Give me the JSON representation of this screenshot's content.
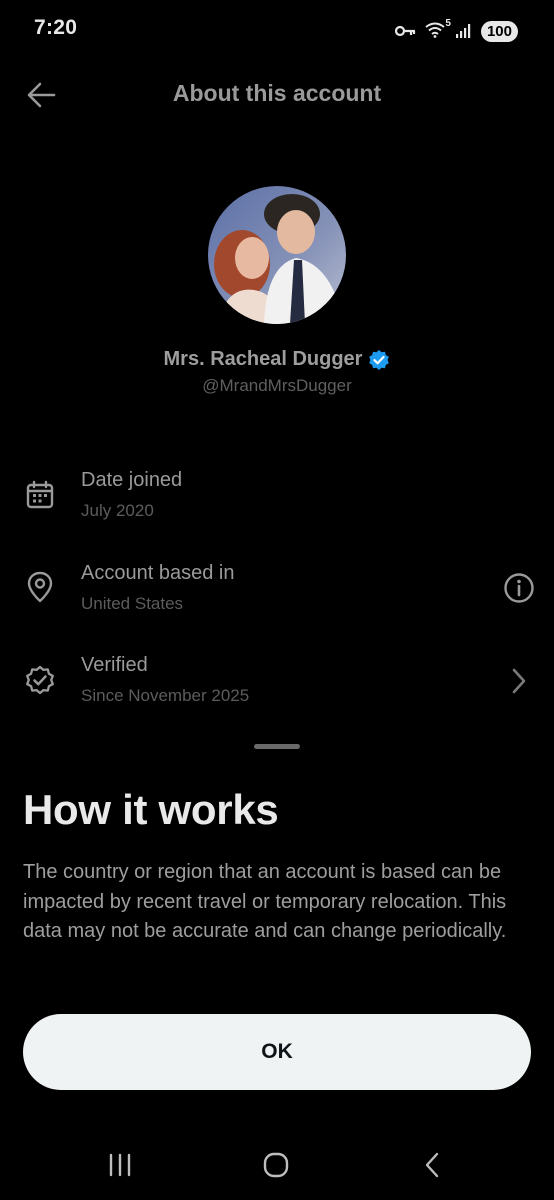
{
  "status_bar": {
    "time": "7:20",
    "network": "5",
    "battery": "100"
  },
  "header": {
    "title": "About this account",
    "back_icon": "arrow-left-icon"
  },
  "profile": {
    "name": "Mrs. Racheal Dugger",
    "handle": "@MrandMrsDugger",
    "verified_color": "#1d9bf0"
  },
  "info": {
    "date_joined": {
      "label": "Date joined",
      "value": "July 2020",
      "icon": "calendar-icon"
    },
    "based_in": {
      "label": "Account based in",
      "value": "United States",
      "icon": "location-pin-icon",
      "trailing_icon": "info-icon"
    },
    "verified": {
      "label": "Verified",
      "value": "Since November 2025",
      "icon": "verified-badge-icon",
      "trailing_icon": "chevron-right-icon"
    }
  },
  "how_it_works": {
    "title": "How it works",
    "body": "The country or region that an account is based can be impacted by recent travel or temporary relocation. This data may not be accurate and can change periodically."
  },
  "ok_label": "OK",
  "nav_bar": {
    "recents_icon": "recents-icon",
    "home_icon": "home-icon",
    "back_icon": "back-icon"
  }
}
